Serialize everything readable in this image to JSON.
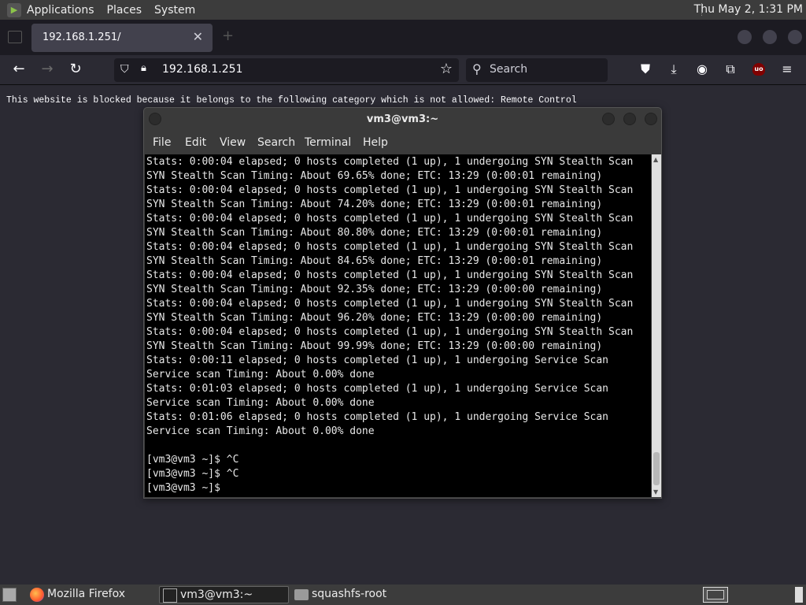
{
  "top_panel": {
    "menus": [
      "Applications",
      "Places",
      "System"
    ],
    "clock": "Thu May  2, 1:31 PM"
  },
  "browser": {
    "tab_title": "192.168.1.251/",
    "url": "192.168.1.251",
    "search_placeholder": "Search",
    "page_message": "This website is blocked because it belongs to the following category which is not allowed: Remote Control"
  },
  "terminal": {
    "title": "vm3@vm3:~",
    "menu": [
      "File",
      "Edit",
      "View",
      "Search",
      "Terminal",
      "Help"
    ],
    "lines": [
      "Stats: 0:00:04 elapsed; 0 hosts completed (1 up), 1 undergoing SYN Stealth Scan",
      "SYN Stealth Scan Timing: About 69.65% done; ETC: 13:29 (0:00:01 remaining)",
      "Stats: 0:00:04 elapsed; 0 hosts completed (1 up), 1 undergoing SYN Stealth Scan",
      "SYN Stealth Scan Timing: About 74.20% done; ETC: 13:29 (0:00:01 remaining)",
      "Stats: 0:00:04 elapsed; 0 hosts completed (1 up), 1 undergoing SYN Stealth Scan",
      "SYN Stealth Scan Timing: About 80.80% done; ETC: 13:29 (0:00:01 remaining)",
      "Stats: 0:00:04 elapsed; 0 hosts completed (1 up), 1 undergoing SYN Stealth Scan",
      "SYN Stealth Scan Timing: About 84.65% done; ETC: 13:29 (0:00:01 remaining)",
      "Stats: 0:00:04 elapsed; 0 hosts completed (1 up), 1 undergoing SYN Stealth Scan",
      "SYN Stealth Scan Timing: About 92.35% done; ETC: 13:29 (0:00:00 remaining)",
      "Stats: 0:00:04 elapsed; 0 hosts completed (1 up), 1 undergoing SYN Stealth Scan",
      "SYN Stealth Scan Timing: About 96.20% done; ETC: 13:29 (0:00:00 remaining)",
      "Stats: 0:00:04 elapsed; 0 hosts completed (1 up), 1 undergoing SYN Stealth Scan",
      "SYN Stealth Scan Timing: About 99.99% done; ETC: 13:29 (0:00:00 remaining)",
      "Stats: 0:00:11 elapsed; 0 hosts completed (1 up), 1 undergoing Service Scan",
      "Service scan Timing: About 0.00% done",
      "Stats: 0:01:03 elapsed; 0 hosts completed (1 up), 1 undergoing Service Scan",
      "Service scan Timing: About 0.00% done",
      "Stats: 0:01:06 elapsed; 0 hosts completed (1 up), 1 undergoing Service Scan",
      "Service scan Timing: About 0.00% done",
      "",
      "[vm3@vm3 ~]$ ^C",
      "[vm3@vm3 ~]$ ^C",
      "[vm3@vm3 ~]$ "
    ]
  },
  "taskbar": {
    "items": [
      "Mozilla Firefox",
      "vm3@vm3:~",
      "squashfs-root"
    ]
  }
}
